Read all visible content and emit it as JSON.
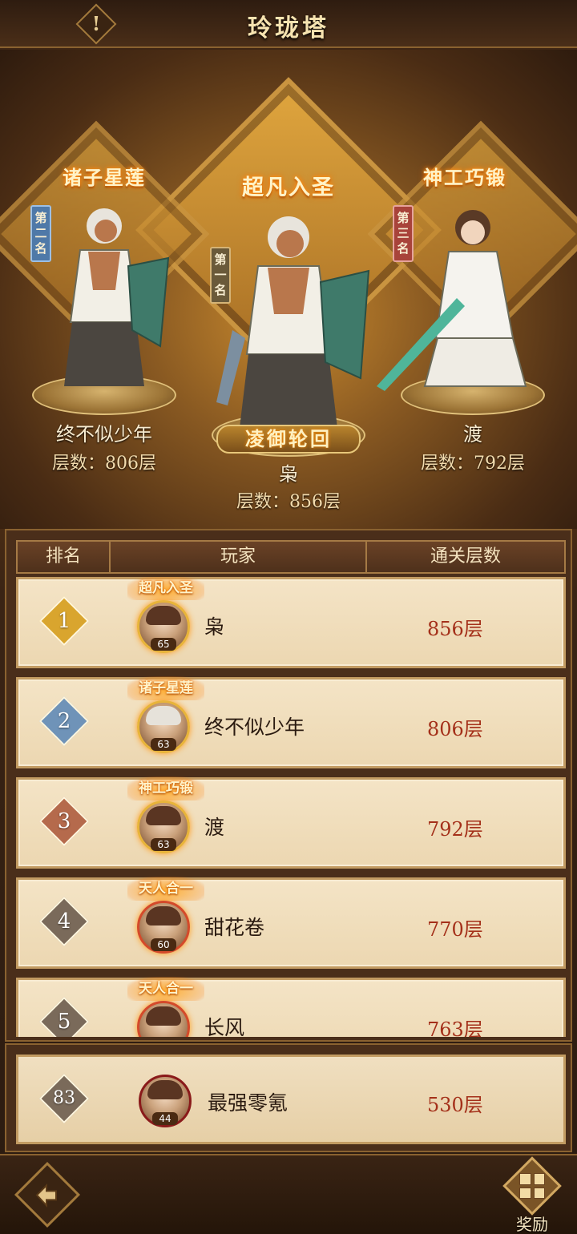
{
  "header": {
    "title": "玲珑塔",
    "info_label": "!"
  },
  "podium": {
    "first": {
      "title": "超凡入圣",
      "rank_tag": "第一名",
      "subtitle": "凌御轮回",
      "name": "枭",
      "floors": "层数：856层"
    },
    "second": {
      "title": "诸子星莲",
      "rank_tag": "第二名",
      "name": "终不似少年",
      "floors": "层数：806层"
    },
    "third": {
      "title": "神工巧锻",
      "rank_tag": "第三名",
      "name": "渡",
      "floors": "层数：792层"
    }
  },
  "table": {
    "headers": [
      "排名",
      "玩家",
      "通关层数"
    ],
    "rows": [
      {
        "rank": "1",
        "title": "超凡入圣",
        "level": "65",
        "name": "枭",
        "floors": "856层",
        "badge_color": "#d9a52e"
      },
      {
        "rank": "2",
        "title": "诸子星莲",
        "level": "63",
        "name": "终不似少年",
        "floors": "806层",
        "badge_color": "#6f93b8"
      },
      {
        "rank": "3",
        "title": "神工巧锻",
        "level": "63",
        "name": "渡",
        "floors": "792层",
        "badge_color": "#b56a4c"
      },
      {
        "rank": "4",
        "title": "天人合一",
        "level": "60",
        "name": "甜花卷",
        "floors": "770层",
        "badge_color": "#7a6a5a"
      },
      {
        "rank": "5",
        "title": "天人合一",
        "level": "",
        "name": "长风",
        "floors": "763层",
        "badge_color": "#7a6a5a"
      }
    ]
  },
  "my_rank": {
    "rank": "83",
    "level": "44",
    "name": "最强零氪",
    "floors": "530层"
  },
  "footer": {
    "back_icon": "back-arrow-icon",
    "reward_label": "奖励"
  },
  "colors": {
    "floor_text": "#a4301a",
    "row_bg": "#f4e4c6",
    "frame": "#8a6230"
  }
}
